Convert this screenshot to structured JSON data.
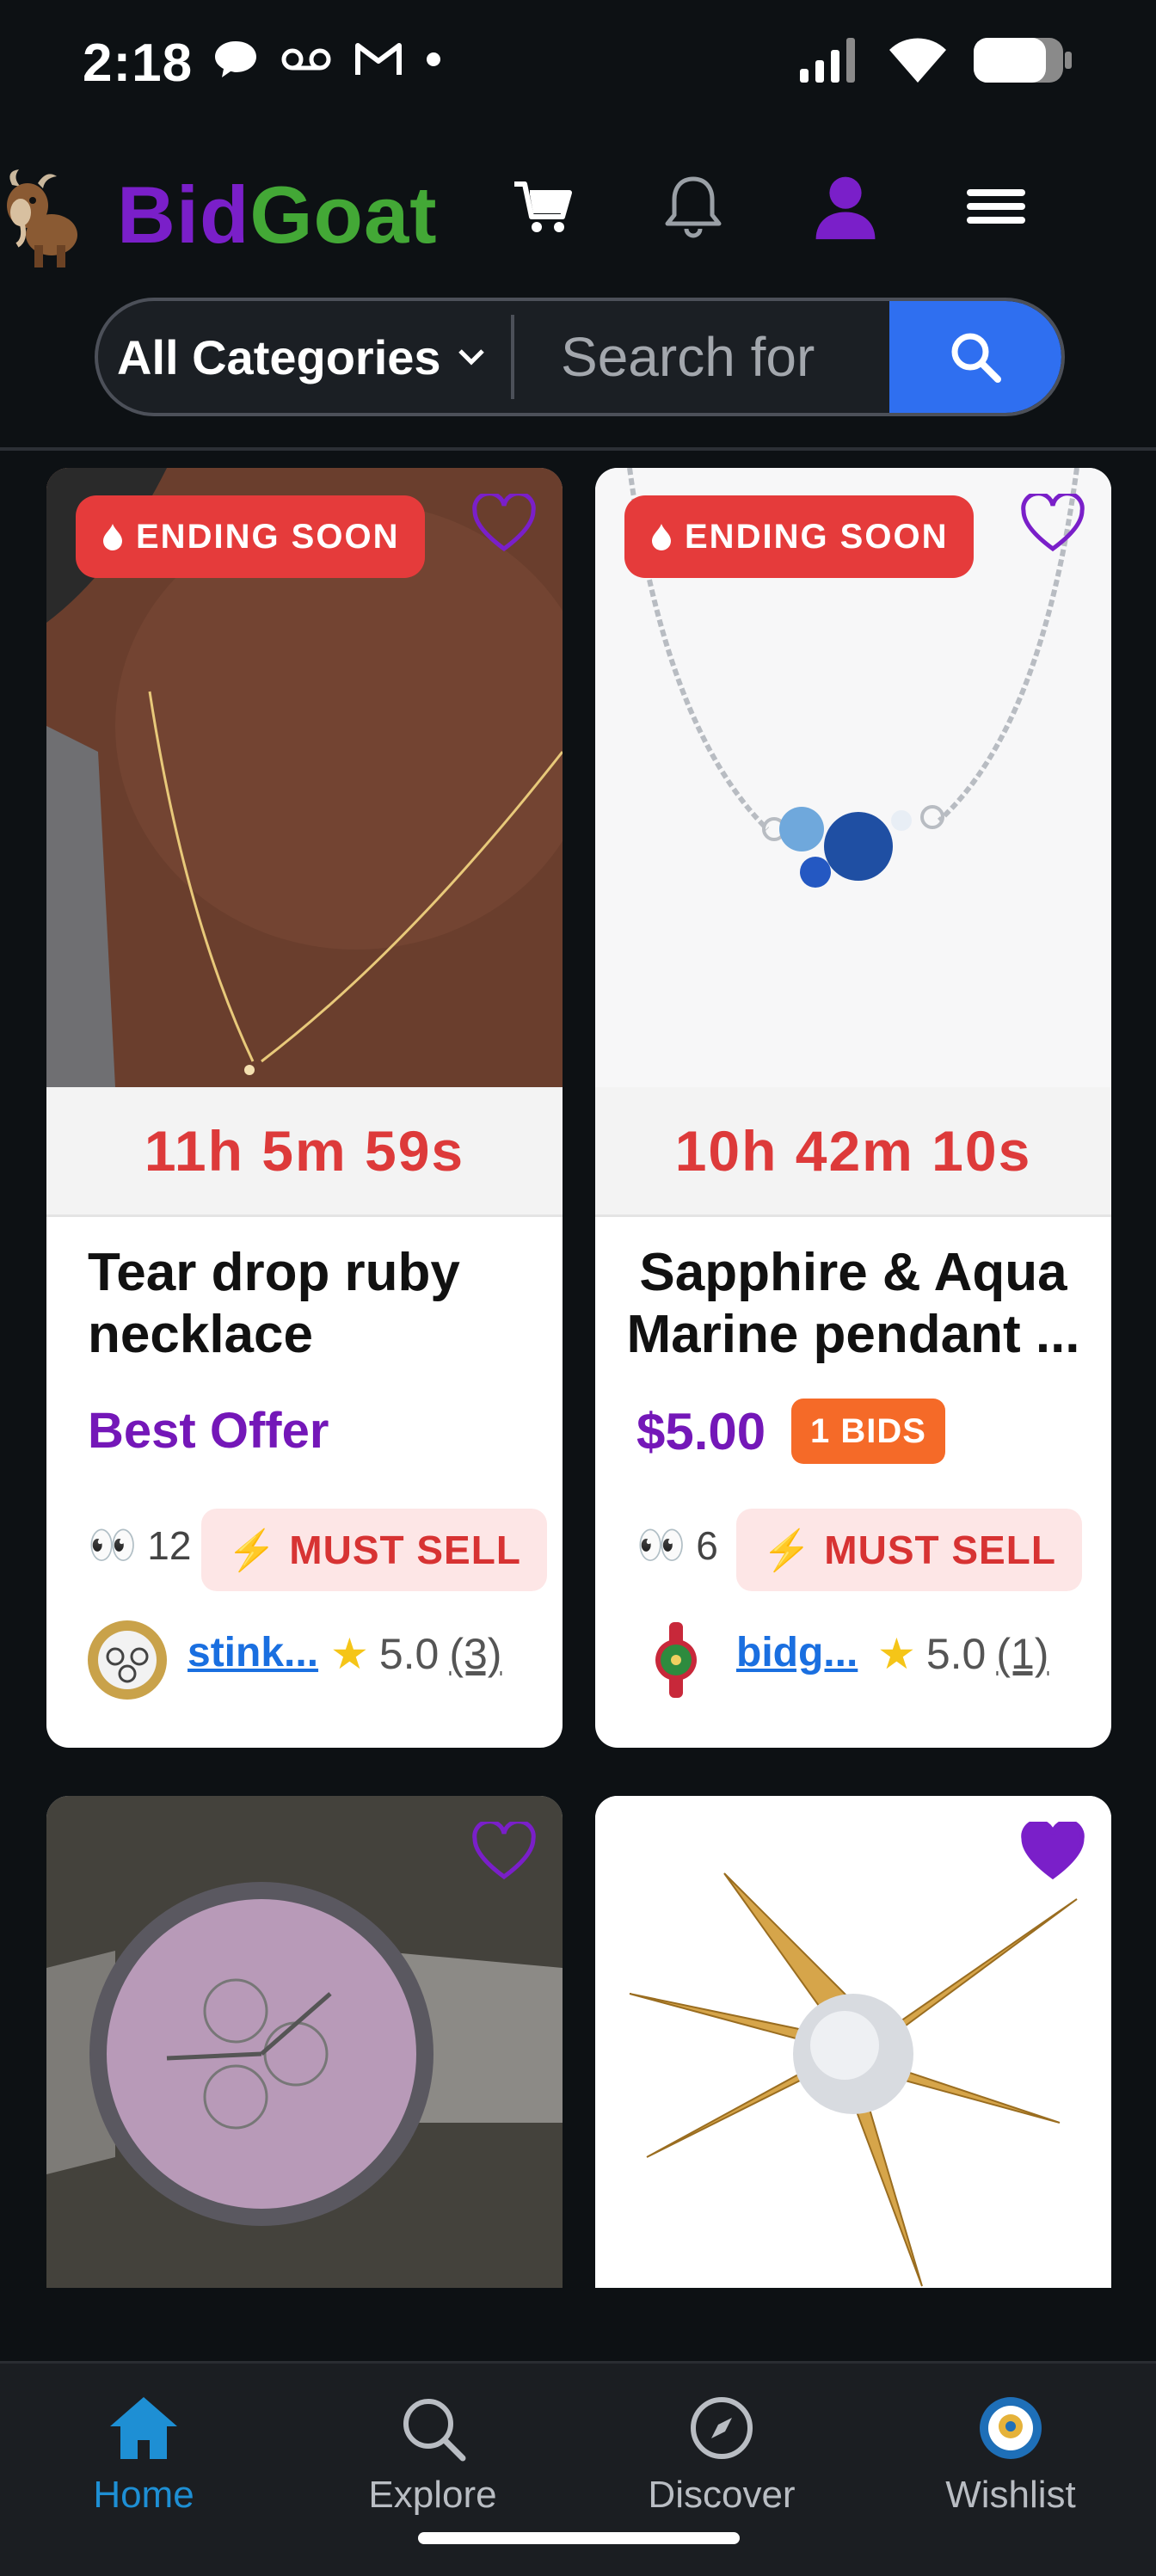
{
  "status_bar": {
    "time": "2:18"
  },
  "header": {
    "brand_part1": "Bid",
    "brand_part2": "Goat"
  },
  "search": {
    "category": "All Categories",
    "placeholder": "Search for"
  },
  "listings": [
    {
      "badge": "ENDING SOON",
      "timer": "11h 5m 59s",
      "title": "Tear drop ruby necklace",
      "offer_label": "Best Offer",
      "views": "12",
      "must_sell": "MUST SELL",
      "seller": "stink...",
      "rating": "5.0",
      "rating_count": "(3)",
      "favorited": false
    },
    {
      "badge": "ENDING SOON",
      "timer": "10h 42m 10s",
      "title_line1": "Sapphire & Aqua",
      "title_line2": "Marine pendant ...",
      "price": "$5.00",
      "bids": "1 BIDS",
      "views": "6",
      "must_sell": "MUST SELL",
      "seller": "bidg...",
      "rating": "5.0",
      "rating_count": "(1)",
      "favorited": false
    },
    {
      "favorited": false
    },
    {
      "favorited": true
    }
  ],
  "bottom_nav": [
    {
      "label": "Home",
      "active": true
    },
    {
      "label": "Explore",
      "active": false
    },
    {
      "label": "Discover",
      "active": false
    },
    {
      "label": "Wishlist",
      "active": false
    }
  ],
  "colors": {
    "accent_purple": "#7417b8",
    "brand_green": "#43a836",
    "badge_red": "#e53b3b",
    "link_blue": "#1a6fe0",
    "nav_active": "#1e8fd4"
  }
}
